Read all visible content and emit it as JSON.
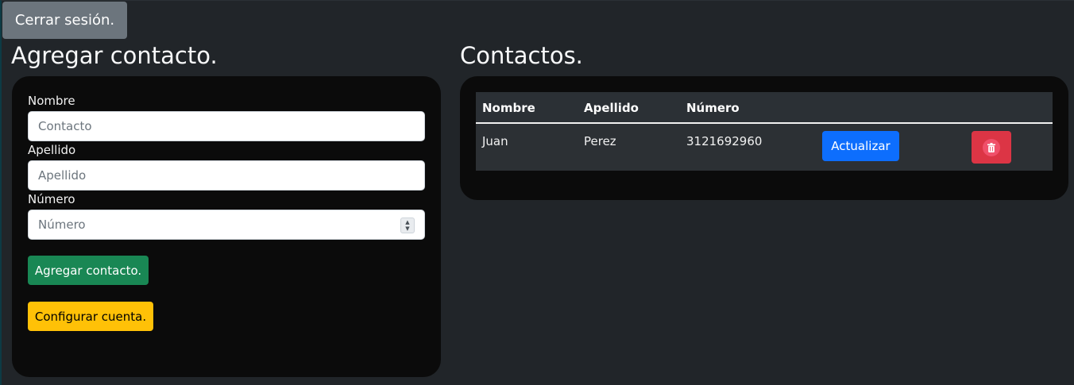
{
  "header": {
    "logout_label": "Cerrar sesión."
  },
  "form": {
    "title": "Agregar contacto.",
    "fields": [
      {
        "label": "Nombre",
        "placeholder": "Contacto",
        "value": ""
      },
      {
        "label": "Apellido",
        "placeholder": "Apellido",
        "value": ""
      },
      {
        "label": "Número",
        "placeholder": "Número",
        "value": ""
      }
    ],
    "submit_label": "Agregar contacto.",
    "settings_label": "Configurar cuenta."
  },
  "contacts": {
    "title": "Contactos.",
    "columns": [
      "Nombre",
      "Apellido",
      "Número"
    ],
    "rows": [
      {
        "nombre": "Juan",
        "apellido": "Perez",
        "numero": "3121692960",
        "update_label": "Actualizar",
        "delete_icon": "trash-icon"
      }
    ]
  },
  "colors": {
    "background": "#212529",
    "card": "#0b0b0b",
    "success": "#198754",
    "warning": "#ffc107",
    "primary": "#0d6efd",
    "danger": "#dc3545",
    "secondary": "#6c757d"
  }
}
